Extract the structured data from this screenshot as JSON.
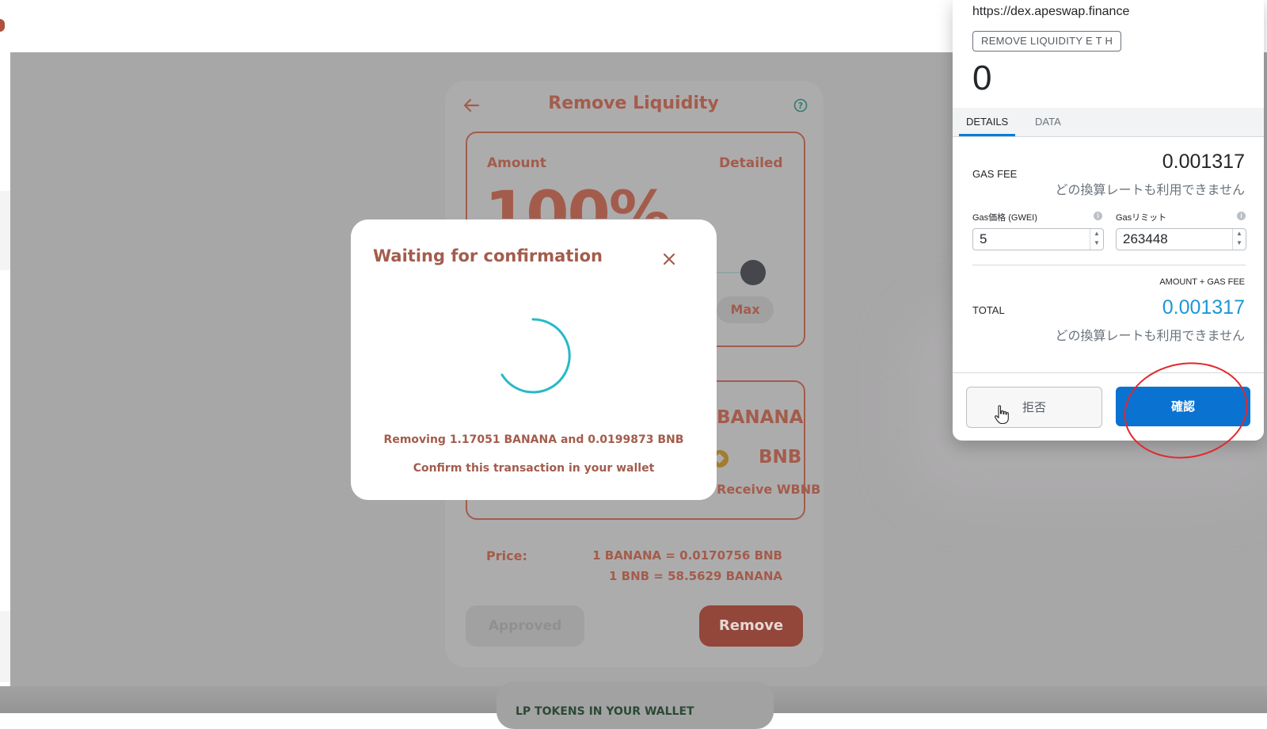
{
  "app": {
    "title": "Remove Liquidity",
    "amount_label": "Amount",
    "detailed_label": "Detailed",
    "amount_percent": "100%",
    "max_label": "Max",
    "token_banana": "BANANA",
    "token_bnb": "BNB",
    "receive_wbnb": "Receive WBNB",
    "price_label": "Price:",
    "price_line1": "1 BANANA = 0.0170756 BNB",
    "price_line2": "1 BNB = 58.5629 BANANA",
    "approved_label": "Approved",
    "remove_label": "Remove",
    "lp_tokens_label": "LP TOKENS IN YOUR WALLET",
    "colors": {
      "brand": "#a35c4c",
      "overlay": "#a8a7a8",
      "remove_bg": "#93463a"
    }
  },
  "modal": {
    "title": "Waiting for confirmation",
    "line1": "Removing 1.17051 BANANA and 0.0199873 BNB",
    "line2": "Confirm this transaction in your wallet",
    "spinner_color": "#25b9c8"
  },
  "metamask": {
    "url": "https://dex.apeswap.finance",
    "method_badge": "REMOVE LIQUIDITY E T H",
    "amount": "0",
    "tabs": [
      "DETAILS",
      "DATA"
    ],
    "active_tab": "DETAILS",
    "gas_fee_label": "GAS FEE",
    "gas_fee_value": "0.001317",
    "no_rate_text": "どの換算レートも利用できません",
    "gas_price_label": "Gas価格 (GWEI)",
    "gas_price_value": "5",
    "gas_limit_label": "Gasリミット",
    "gas_limit_value": "263448",
    "amount_gas_fee_label": "AMOUNT + GAS FEE",
    "total_label": "TOTAL",
    "total_value": "0.001317",
    "reject_label": "拒否",
    "confirm_label": "確認",
    "colors": {
      "primary": "#0a72d1",
      "total": "#1d97d6",
      "highlight_circle": "#e0292c"
    }
  }
}
